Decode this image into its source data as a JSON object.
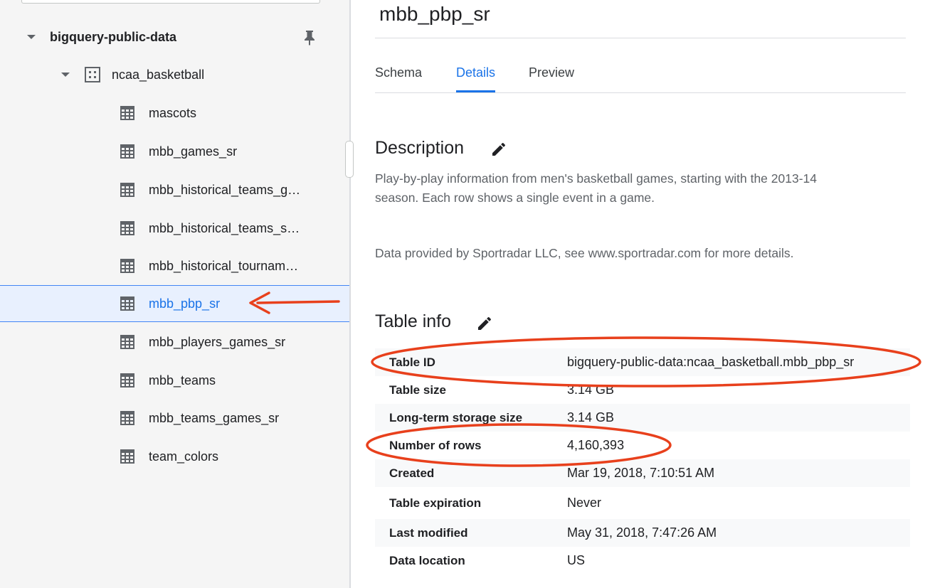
{
  "explorer": {
    "project": {
      "label": "bigquery-public-data"
    },
    "dataset": {
      "label": "ncaa_basketball"
    },
    "tables": [
      {
        "label": "mascots"
      },
      {
        "label": "mbb_games_sr"
      },
      {
        "label": "mbb_historical_teams_g…"
      },
      {
        "label": "mbb_historical_teams_s…"
      },
      {
        "label": "mbb_historical_tournam…"
      },
      {
        "label": "mbb_pbp_sr",
        "selected": true
      },
      {
        "label": "mbb_players_games_sr"
      },
      {
        "label": "mbb_teams"
      },
      {
        "label": "mbb_teams_games_sr"
      },
      {
        "label": "team_colors"
      }
    ]
  },
  "details": {
    "title": "mbb_pbp_sr",
    "tabs": [
      {
        "label": "Schema"
      },
      {
        "label": "Details",
        "active": true
      },
      {
        "label": "Preview"
      }
    ],
    "description": {
      "heading": "Description",
      "line1": "Play-by-play information from men's basketball games, starting with the 2013-14",
      "line2": "season. Each row shows a single event in a game.",
      "provider": "Data provided by Sportradar LLC, see www.sportradar.com for more details."
    },
    "table_info": {
      "heading": "Table info",
      "rows": [
        {
          "key": "Table ID",
          "value": "bigquery-public-data:ncaa_basketball.mbb_pbp_sr"
        },
        {
          "key": "Table size",
          "value": "3.14 GB"
        },
        {
          "key": "Long-term storage size",
          "value": "3.14 GB"
        },
        {
          "key": "Number of rows",
          "value": "4,160,393"
        },
        {
          "key": "Created",
          "value": "Mar 19, 2018, 7:10:51 AM"
        },
        {
          "key": "Table expiration",
          "value": "Never"
        },
        {
          "key": "Last modified",
          "value": "May 31, 2018, 7:47:26 AM"
        },
        {
          "key": "Data location",
          "value": "US"
        }
      ]
    }
  },
  "colors": {
    "accent": "#1a73e8",
    "annotation": "#e8401c",
    "selected_bg": "#e8f0fe"
  },
  "icons": {
    "pin": "pin-icon",
    "dataset": "dataset-icon",
    "table": "table-icon",
    "edit": "pencil-icon"
  }
}
